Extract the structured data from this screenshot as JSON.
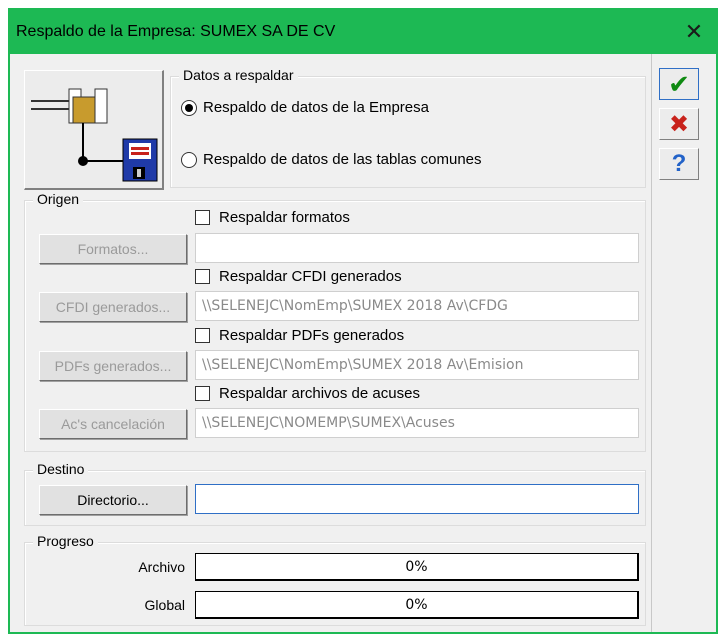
{
  "window": {
    "title": "Respaldo de la Empresa: SUMEX SA DE CV",
    "close_label": "✕"
  },
  "side_buttons": {
    "ok_icon": "✔",
    "cancel_icon": "✖",
    "help_icon": "?"
  },
  "datos": {
    "group_label": "Datos a respaldar",
    "option_empresa": "Respaldo de datos de la Empresa",
    "option_tablas": "Respaldo de datos de las tablas comunes",
    "selected": "empresa"
  },
  "origen": {
    "group_label": "Origen",
    "formatos": {
      "check_label": "Respaldar formatos",
      "button": "Formatos...",
      "path": ""
    },
    "cfdi": {
      "check_label": "Respaldar CFDI generados",
      "button": "CFDI generados...",
      "path": "\\\\SELENEJC\\NomEmp\\SUMEX 2018 Av\\CFDG"
    },
    "pdfs": {
      "check_label": "Respaldar PDFs generados",
      "button": "PDFs generados...",
      "path": "\\\\SELENEJC\\NomEmp\\SUMEX 2018 Av\\Emision"
    },
    "acuses": {
      "check_label": "Respaldar archivos de acuses",
      "button": "Ac's cancelación",
      "path": "\\\\SELENEJC\\NOMEMP\\SUMEX\\Acuses"
    }
  },
  "destino": {
    "group_label": "Destino",
    "button": "Directorio...",
    "path": ""
  },
  "progreso": {
    "group_label": "Progreso",
    "archivo_label": "Archivo",
    "archivo_value": "0%",
    "global_label": "Global",
    "global_value": "0%"
  }
}
